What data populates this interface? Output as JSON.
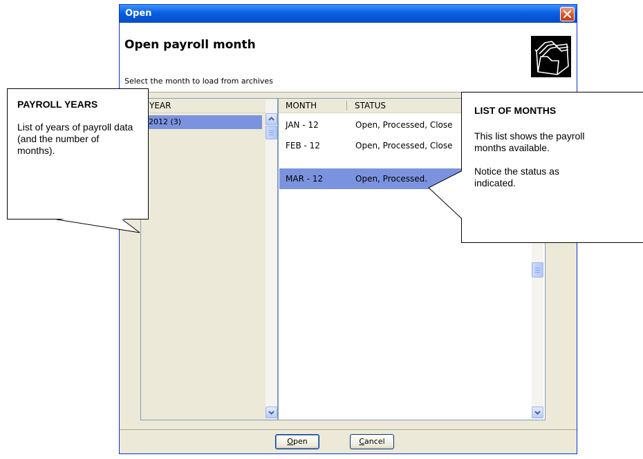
{
  "window": {
    "title": "Open",
    "heading": "Open payroll month",
    "subtitle": "Select the month to load from archives",
    "icon": "folders-icon"
  },
  "years": {
    "column_header": "YEAR",
    "rows": [
      {
        "label": "2012 (3)",
        "selected": true
      }
    ]
  },
  "months": {
    "column_headers": [
      "MONTH",
      "STATUS"
    ],
    "rows": [
      {
        "month": "JAN - 12",
        "status": "Open, Processed, Close",
        "selected": false
      },
      {
        "month": "FEB - 12",
        "status": "Open, Processed, Close",
        "selected": false
      },
      {
        "month": "MAR - 12",
        "status": "Open, Processed.",
        "selected": true
      }
    ]
  },
  "buttons": {
    "open_mnemonic": "O",
    "open_rest": "pen",
    "cancel_mnemonic": "C",
    "cancel_rest": "ancel"
  },
  "callouts": {
    "years": {
      "title": "PAYROLL YEARS",
      "body": "List of years of payroll data (and the number of months)."
    },
    "months": {
      "title": "LIST OF MONTHS",
      "body1": "This list shows the payroll months available.",
      "body2": "Notice the status as indicated."
    }
  },
  "colors": {
    "titlebar": "#0a5fe0",
    "selection": "#7b93df",
    "dialog_bg": "#ece9d8"
  }
}
